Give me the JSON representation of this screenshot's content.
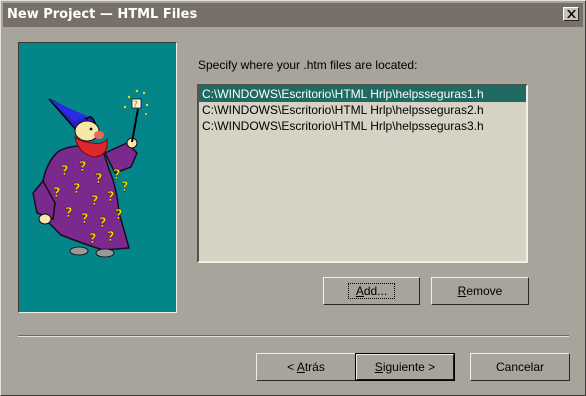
{
  "window": {
    "title": "New Project — HTML Files",
    "close_symbol": "×"
  },
  "illustration": {
    "icon": "wizard-illustration"
  },
  "prompt": "Specify where your .htm files are located:",
  "files": [
    "C:\\WINDOWS\\Escritorio\\HTML Hrlp\\helpsseguras1.h",
    "C:\\WINDOWS\\Escritorio\\HTML Hrlp\\helpsseguras2.h",
    "C:\\WINDOWS\\Escritorio\\HTML Hrlp\\helpsseguras3.h"
  ],
  "selected_index": 0,
  "buttons": {
    "add": {
      "accel": "A",
      "rest": "dd..."
    },
    "remove": {
      "accel": "R",
      "rest": "emove"
    },
    "back": {
      "prefix": "< ",
      "accel": "A",
      "rest": "trás"
    },
    "next": {
      "accel": "S",
      "rest": "iguiente >"
    },
    "cancel": "Cancelar"
  },
  "colors": {
    "title_bar": "#767068",
    "wizard_background": "#04858a",
    "list_selection": "#1f6a62"
  }
}
